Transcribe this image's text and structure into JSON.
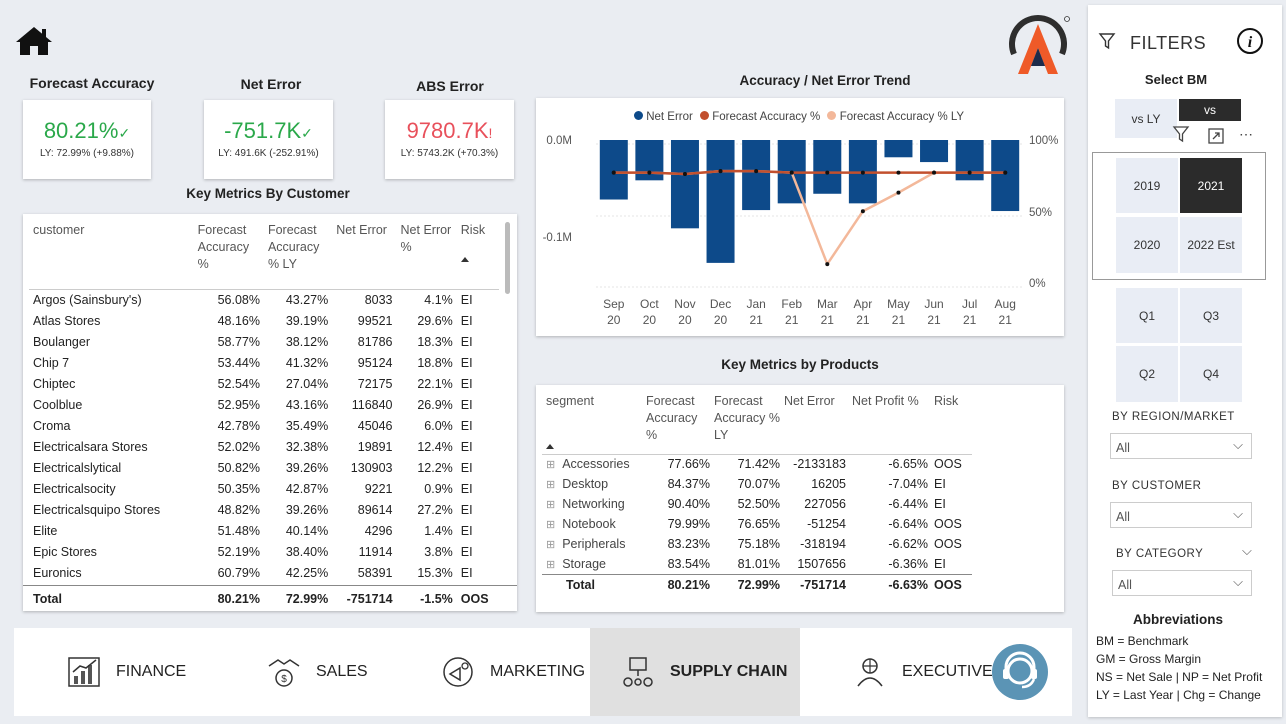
{
  "kpis": [
    {
      "title": "Forecast Accuracy",
      "value": "80.21%",
      "mark": "✓",
      "sub": "LY: 72.99% (+9.88%)",
      "color": "#2aa84a"
    },
    {
      "title": "Net Error",
      "value": "-751.7K",
      "mark": "✓",
      "sub": "LY: 491.6K (-252.91%)",
      "color": "#2aa84a"
    },
    {
      "title": "ABS Error",
      "value": "9780.7K",
      "mark": "!",
      "sub": "LY: 5743.2K (+70.3%)",
      "color": "#e8505b"
    }
  ],
  "customer_table": {
    "title": "Key Metrics By Customer",
    "headers": [
      "customer",
      "Forecast Accuracy %",
      "Forecast Accuracy % LY",
      "Net Error",
      "Net Error %",
      "Risk"
    ],
    "rows": [
      [
        "Argos (Sainsbury's)",
        "56.08%",
        "43.27%",
        "8033",
        "4.1%",
        "EI"
      ],
      [
        "Atlas Stores",
        "48.16%",
        "39.19%",
        "99521",
        "29.6%",
        "EI"
      ],
      [
        "Boulanger",
        "58.77%",
        "38.12%",
        "81786",
        "18.3%",
        "EI"
      ],
      [
        "Chip 7",
        "53.44%",
        "41.32%",
        "95124",
        "18.8%",
        "EI"
      ],
      [
        "Chiptec",
        "52.54%",
        "27.04%",
        "72175",
        "22.1%",
        "EI"
      ],
      [
        "Coolblue",
        "52.95%",
        "43.16%",
        "116840",
        "26.9%",
        "EI"
      ],
      [
        "Croma",
        "42.78%",
        "35.49%",
        "45046",
        "6.0%",
        "EI"
      ],
      [
        "Electricalsara Stores",
        "52.02%",
        "32.38%",
        "19891",
        "12.4%",
        "EI"
      ],
      [
        "Electricalslytical",
        "50.82%",
        "39.26%",
        "130903",
        "12.2%",
        "EI"
      ],
      [
        "Electricalsocity",
        "50.35%",
        "42.87%",
        "9221",
        "0.9%",
        "EI"
      ],
      [
        "Electricalsquipo Stores",
        "48.82%",
        "39.26%",
        "89614",
        "27.2%",
        "EI"
      ],
      [
        "Elite",
        "51.48%",
        "40.14%",
        "4296",
        "1.4%",
        "EI"
      ],
      [
        "Epic Stores",
        "52.19%",
        "38.40%",
        "11914",
        "3.8%",
        "EI"
      ],
      [
        "Euronics",
        "60.79%",
        "42.25%",
        "58391",
        "15.3%",
        "EI"
      ]
    ],
    "total": [
      "Total",
      "80.21%",
      "72.99%",
      "-751714",
      "-1.5%",
      "OOS"
    ]
  },
  "trend": {
    "title": "Accuracy / Net Error Trend",
    "legend": [
      "Net Error",
      "Forecast Accuracy %",
      "Forecast Accuracy % LY"
    ],
    "colors": {
      "net_error": "#0d4a8a",
      "fa": "#c2502e",
      "fa_ly": "#f3b89a"
    },
    "y_left_ticks": [
      "0.0M",
      "-0.1M"
    ],
    "y_right_ticks": [
      "100%",
      "50%",
      "0%"
    ]
  },
  "chart_data": {
    "type": "bar",
    "x": [
      [
        "Sep",
        "20"
      ],
      [
        "Oct",
        "20"
      ],
      [
        "Nov",
        "20"
      ],
      [
        "Dec",
        "20"
      ],
      [
        "Jan",
        "21"
      ],
      [
        "Feb",
        "21"
      ],
      [
        "Mar",
        "21"
      ],
      [
        "Apr",
        "21"
      ],
      [
        "May",
        "21"
      ],
      [
        "Jun",
        "21"
      ],
      [
        "Jul",
        "21"
      ],
      [
        "Aug",
        "21"
      ]
    ],
    "series": [
      {
        "name": "Net Error",
        "values": [
          -0.062,
          -0.042,
          -0.092,
          -0.128,
          -0.073,
          -0.066,
          -0.056,
          -0.066,
          -0.018,
          -0.023,
          -0.042,
          -0.074
        ]
      },
      {
        "name": "Forecast Accuracy %",
        "values": [
          80,
          80,
          79,
          81,
          81,
          80,
          80,
          80,
          80,
          80,
          80,
          80
        ]
      },
      {
        "name": "Forecast Accuracy % LY",
        "values": [
          80,
          80,
          79,
          81,
          81,
          80,
          16,
          53,
          66,
          80,
          80,
          80
        ]
      }
    ],
    "y_left_range": [
      -0.14,
      0.005
    ],
    "y_right_range": [
      0,
      100
    ]
  },
  "product_table": {
    "title": "Key Metrics by Products",
    "headers": [
      "segment",
      "Forecast Accuracy %",
      "Forecast Accuracy % LY",
      "Net Error",
      "Net Profit %",
      "Risk"
    ],
    "rows": [
      [
        "Accessories",
        "77.66%",
        "71.42%",
        "-2133183",
        "-6.65%",
        "OOS"
      ],
      [
        "Desktop",
        "84.37%",
        "70.07%",
        "16205",
        "-7.04%",
        "EI"
      ],
      [
        "Networking",
        "90.40%",
        "52.50%",
        "227056",
        "-6.44%",
        "EI"
      ],
      [
        "Notebook",
        "79.99%",
        "76.65%",
        "-51254",
        "-6.64%",
        "OOS"
      ],
      [
        "Peripherals",
        "83.23%",
        "75.18%",
        "-318194",
        "-6.62%",
        "OOS"
      ],
      [
        "Storage",
        "83.54%",
        "81.01%",
        "1507656",
        "-6.36%",
        "EI"
      ]
    ],
    "total": [
      "Total",
      "80.21%",
      "72.99%",
      "-751714",
      "-6.63%",
      "OOS"
    ]
  },
  "filters": {
    "title": "FILTERS",
    "select_bm": "Select BM",
    "bm_options": [
      "vs LY",
      "vs"
    ],
    "years": [
      "2019",
      "2021",
      "2020",
      "2022 Est"
    ],
    "quarters": [
      "Q1",
      "Q3",
      "Q2",
      "Q4"
    ],
    "region_label": "BY REGION/MARKET",
    "region_value": "All",
    "customer_label": "BY CUSTOMER",
    "customer_value": "All",
    "category_label": "BY CATEGORY",
    "category_value": "All",
    "abbr_title": "Abbreviations",
    "abbr": [
      "BM = Benchmark",
      "GM = Gross Margin",
      "NS = Net Sale | NP = Net Profit",
      "LY = Last Year | Chg = Change"
    ]
  },
  "nav": [
    "FINANCE",
    "SALES",
    "MARKETING",
    "SUPPLY CHAIN",
    "EXECUTIVE"
  ]
}
